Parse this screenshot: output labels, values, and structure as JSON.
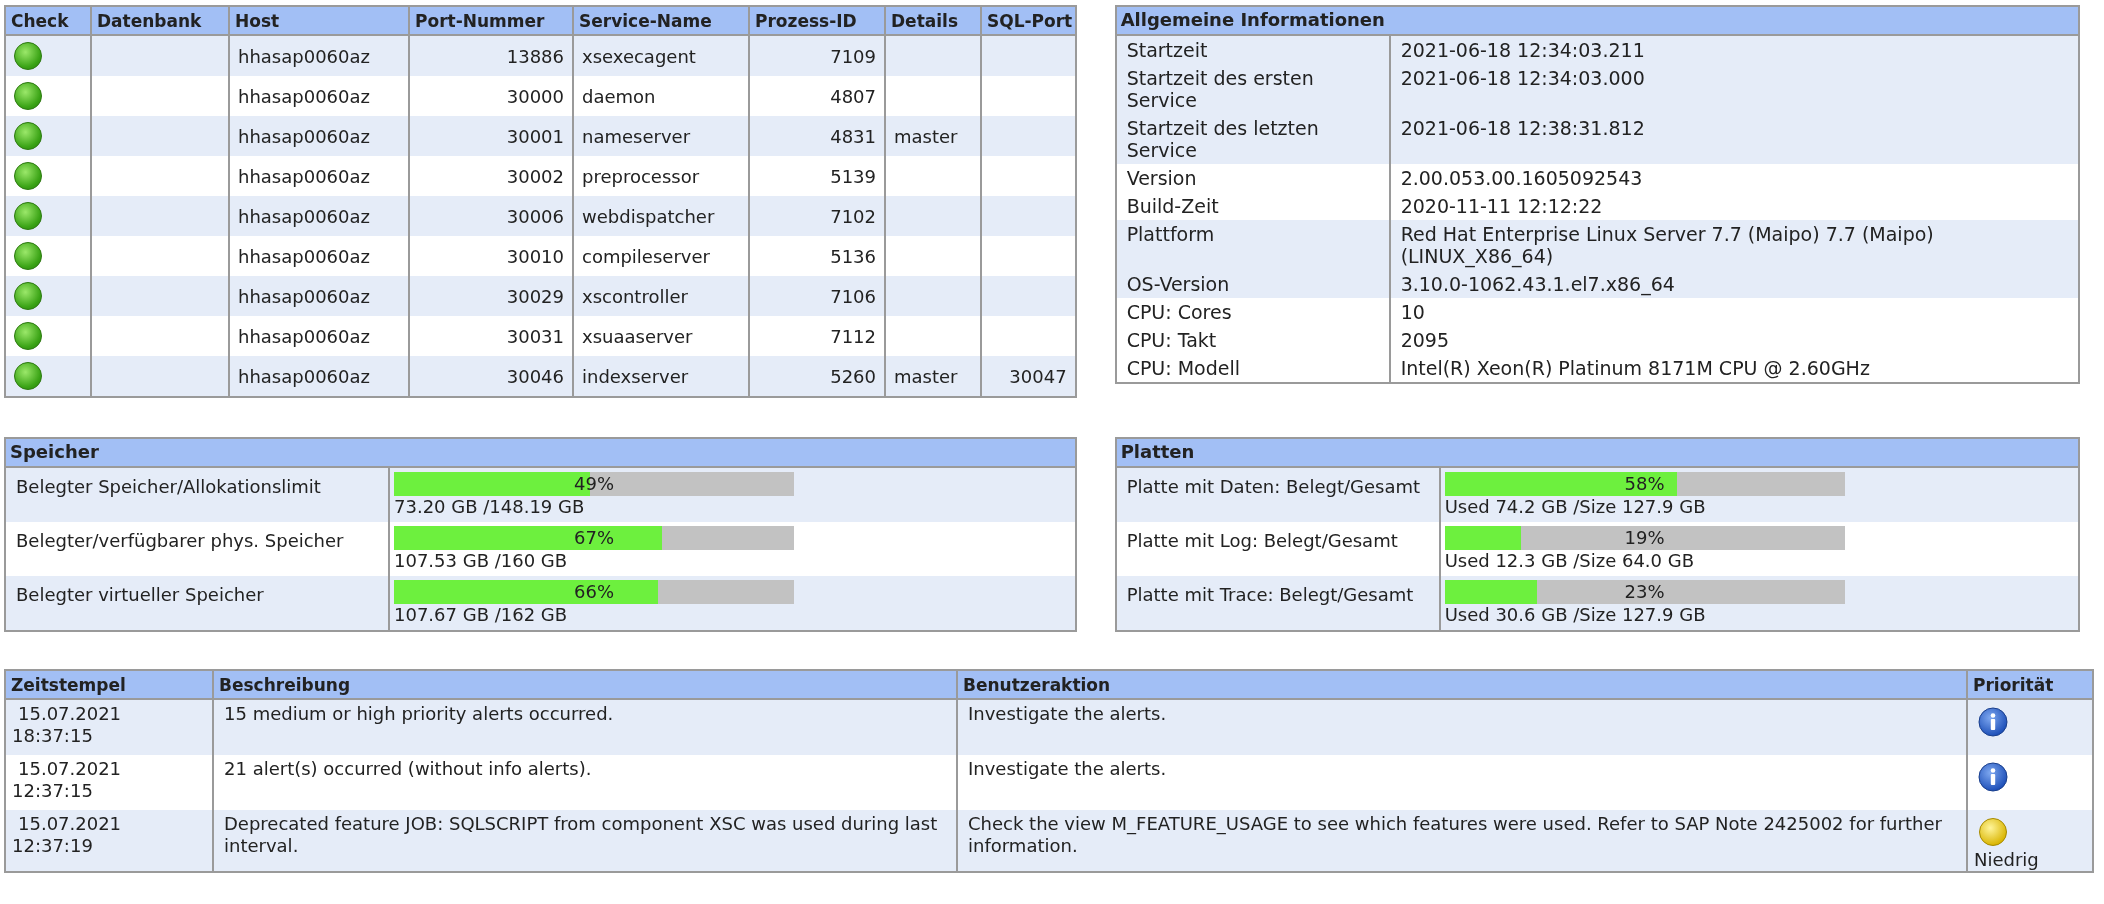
{
  "services": {
    "columns": [
      "Check",
      "Datenbank",
      "Host",
      "Port-Nummer",
      "Service-Name",
      "Prozess-ID",
      "Details",
      "SQL-Port"
    ],
    "rows": [
      {
        "ok": true,
        "database": "",
        "host": "hhasap0060az",
        "port": "13886",
        "service": "xsexecagent",
        "pid": "7109",
        "details": "",
        "sql_port": ""
      },
      {
        "ok": true,
        "database": "",
        "host": "hhasap0060az",
        "port": "30000",
        "service": "daemon",
        "pid": "4807",
        "details": "",
        "sql_port": ""
      },
      {
        "ok": true,
        "database": "",
        "host": "hhasap0060az",
        "port": "30001",
        "service": "nameserver",
        "pid": "4831",
        "details": "master",
        "sql_port": ""
      },
      {
        "ok": true,
        "database": "",
        "host": "hhasap0060az",
        "port": "30002",
        "service": "preprocessor",
        "pid": "5139",
        "details": "",
        "sql_port": ""
      },
      {
        "ok": true,
        "database": "",
        "host": "hhasap0060az",
        "port": "30006",
        "service": "webdispatcher",
        "pid": "7102",
        "details": "",
        "sql_port": ""
      },
      {
        "ok": true,
        "database": "",
        "host": "hhasap0060az",
        "port": "30010",
        "service": "compileserver",
        "pid": "5136",
        "details": "",
        "sql_port": ""
      },
      {
        "ok": true,
        "database": "",
        "host": "hhasap0060az",
        "port": "30029",
        "service": "xscontroller",
        "pid": "7106",
        "details": "",
        "sql_port": ""
      },
      {
        "ok": true,
        "database": "",
        "host": "hhasap0060az",
        "port": "30031",
        "service": "xsuaaserver",
        "pid": "7112",
        "details": "",
        "sql_port": ""
      },
      {
        "ok": true,
        "database": "",
        "host": "hhasap0060az",
        "port": "30046",
        "service": "indexserver",
        "pid": "5260",
        "details": "master",
        "sql_port": "30047"
      }
    ]
  },
  "general_info": {
    "title": "Allgemeine Informationen",
    "groups": [
      [
        {
          "label": "Startzeit",
          "value": "2021-06-18 12:34:03.211"
        },
        {
          "label": "Startzeit des ersten Service",
          "value": "2021-06-18 12:34:03.000"
        },
        {
          "label": "Startzeit des letzten Service",
          "value": "2021-06-18 12:38:31.812"
        }
      ],
      [
        {
          "label": "Version",
          "value": "2.00.053.00.1605092543"
        },
        {
          "label": "Build-Zeit",
          "value": "2020-11-11 12:12:22"
        }
      ],
      [
        {
          "label": "Plattform",
          "value": "Red Hat Enterprise Linux Server 7.7 (Maipo) 7.7 (Maipo) (LINUX_X86_64)"
        },
        {
          "label": "OS-Version",
          "value": "3.10.0-1062.43.1.el7.x86_64"
        }
      ],
      [
        {
          "label": "CPU: Cores",
          "value": "10"
        },
        {
          "label": "CPU: Takt",
          "value": "2095"
        },
        {
          "label": "CPU: Modell",
          "value": "Intel(R) Xeon(R) Platinum 8171M CPU @ 2.60GHz"
        }
      ]
    ]
  },
  "memory": {
    "title": "Speicher",
    "rows": [
      {
        "label": "Belegter Speicher/Allokationslimit",
        "level": 0.49,
        "percent": "49%",
        "detail": "73.20 GB /148.19 GB"
      },
      {
        "label": "Belegter/verfügbarer phys. Speicher",
        "level": 0.67,
        "percent": "67%",
        "detail": "107.53 GB /160 GB"
      },
      {
        "label": "Belegter virtueller Speicher",
        "level": 0.66,
        "percent": "66%",
        "detail": "107.67 GB /162 GB"
      }
    ]
  },
  "disks": {
    "title": "Platten",
    "rows": [
      {
        "label": "Platte mit Daten: Belegt/Gesamt",
        "level": 0.58,
        "percent": "58%",
        "detail": "Used 74.2 GB /Size 127.9 GB"
      },
      {
        "label": "Platte mit Log: Belegt/Gesamt",
        "level": 0.19,
        "percent": "19%",
        "detail": "Used 12.3 GB /Size 64.0 GB"
      },
      {
        "label": "Platte mit Trace: Belegt/Gesamt",
        "level": 0.23,
        "percent": "23%",
        "detail": "Used 30.6 GB /Size 127.9 GB"
      }
    ]
  },
  "alerts": {
    "columns": [
      "Zeitstempel",
      "Beschreibung",
      "Benutzeraktion",
      "Priorität"
    ],
    "rows": [
      {
        "date": "15.07.2021",
        "time": "18:37:15",
        "description": "15 medium or high priority alerts occurred.",
        "action": "Investigate the alerts.",
        "priority": {
          "kind": "info"
        }
      },
      {
        "date": "15.07.2021",
        "time": "12:37:15",
        "description": "21 alert(s) occurred (without info alerts).",
        "action": "Investigate the alerts.",
        "priority": {
          "kind": "info"
        }
      },
      {
        "date": "15.07.2021",
        "time": "12:37:19",
        "description": "Deprecated feature JOB: SQLSCRIPT from component XSC was used during last interval.",
        "action": "Check the view M_FEATURE_USAGE to see which features were used. Refer to SAP Note 2425002 for further information.",
        "priority": {
          "kind": "low",
          "label": "Niedrig"
        }
      }
    ]
  }
}
